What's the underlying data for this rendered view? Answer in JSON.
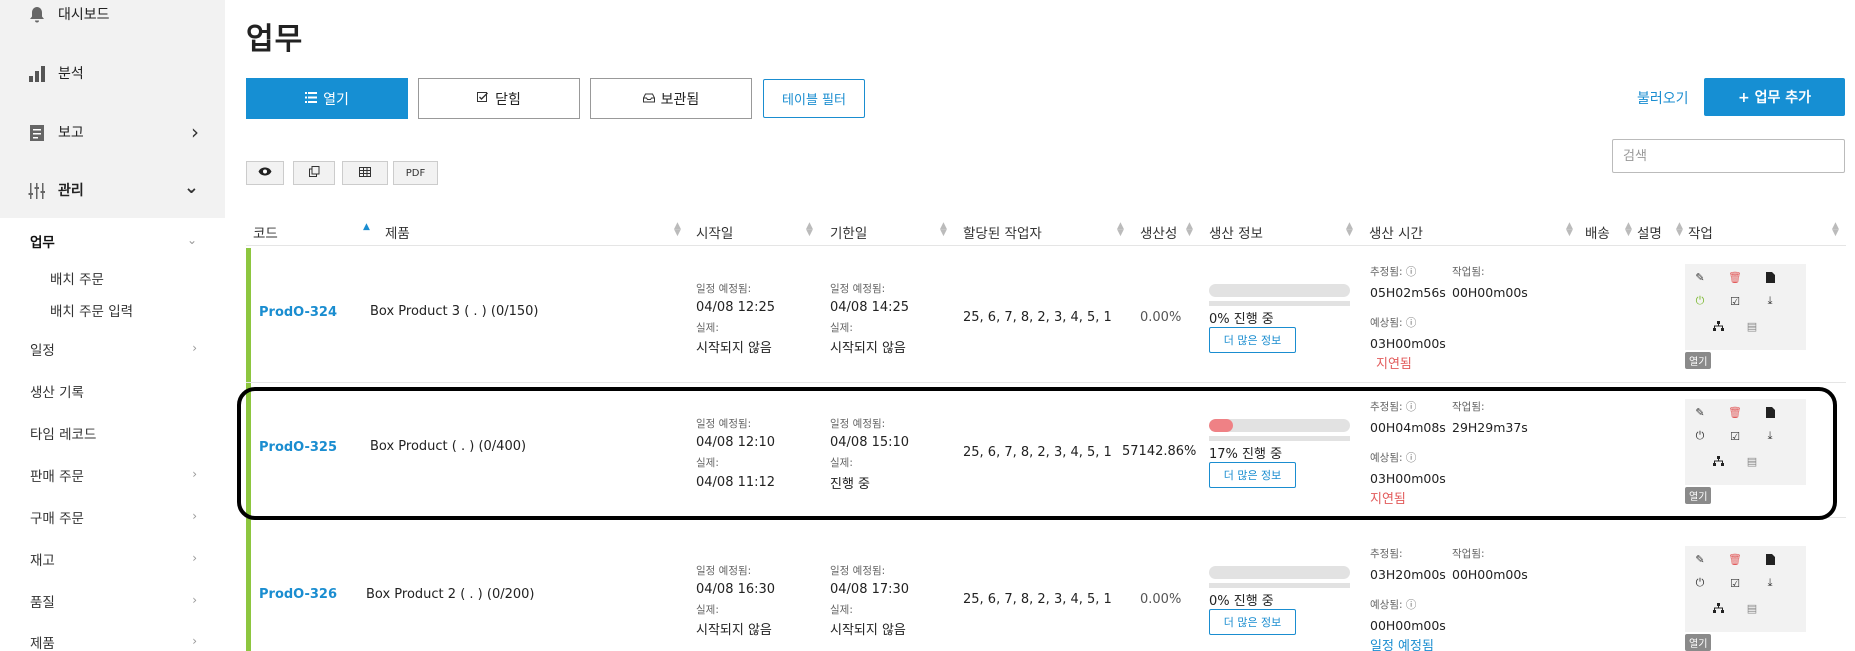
{
  "sidebar": {
    "top_items": [
      {
        "label": "대시보드",
        "icon": "bell-icon"
      },
      {
        "label": "분석",
        "icon": "bar-chart-icon"
      },
      {
        "label": "보고",
        "icon": "report-icon",
        "chevron": "›"
      },
      {
        "label": "관리",
        "icon": "sliders-icon",
        "chevron": "⌄"
      }
    ],
    "items": [
      {
        "label": "업무",
        "active": true
      },
      {
        "label": "배치 주문",
        "sub": true
      },
      {
        "label": "배치 주문 입력",
        "sub": true
      },
      {
        "label": "일정"
      },
      {
        "label": "생산 기록"
      },
      {
        "label": "타임 레코드"
      },
      {
        "label": "판매 주문"
      },
      {
        "label": "구매 주문"
      },
      {
        "label": "재고"
      },
      {
        "label": "품질"
      },
      {
        "label": "제품"
      }
    ]
  },
  "page": {
    "title": "업무",
    "tabs": [
      {
        "label": "열기",
        "icon": "list-icon",
        "active": true
      },
      {
        "label": "닫힘",
        "icon": "check-square-icon"
      },
      {
        "label": "보관됨",
        "icon": "inbox-icon"
      }
    ],
    "table_filter": "테이블 필터",
    "load_link": "불러오기",
    "add_button": "+ 업무 추가",
    "search_placeholder": "검색",
    "small_buttons": [
      {
        "icon": "eye-icon"
      },
      {
        "icon": "copy-icon"
      },
      {
        "icon": "table-icon"
      },
      {
        "label": "PDF"
      }
    ]
  },
  "table": {
    "columns": [
      "코드",
      "제품",
      "시작일",
      "기한일",
      "할당된 작업자",
      "생산성",
      "생산 정보",
      "생산 시간",
      "배송",
      "설명",
      "작업"
    ],
    "labels": {
      "scheduled": "일정 예정됨:",
      "actual": "실제:",
      "estimated": "추정됨:",
      "worked": "작업됨:",
      "expected": "예상됨:",
      "more_info": "더 많은 정보",
      "open_badge": "열기"
    },
    "rows": [
      {
        "code": "ProdO-324",
        "product": "Box Product 3 ( . ) (0/150)",
        "start_sched": "04/08   12:25",
        "start_actual": "시작되지 않음",
        "due_sched": "04/08   14:25",
        "due_actual": "시작되지 않음",
        "workers": "25, 6, 7, 8, 2, 3, 4, 5, 1",
        "productivity": "0.00%",
        "progress": 0,
        "progress_text": "0% 진행 중",
        "estimated": "05H02m56s",
        "worked": "00H00m00s",
        "expected": "03H00m00s",
        "status": "지연됨",
        "status_type": "late"
      },
      {
        "code": "ProdO-325",
        "product": "Box Product ( . ) (0/400)",
        "start_sched": "04/08   12:10",
        "start_actual": "04/08   11:12",
        "due_sched": "04/08   15:10",
        "due_actual": "진행 중",
        "workers": "25, 6, 7, 8, 2, 3, 4, 5, 1",
        "productivity": "57142.86%",
        "progress": 17,
        "progress_text": "17% 진행 중",
        "estimated": "00H04m08s",
        "worked": "29H29m37s",
        "expected": "03H00m00s",
        "status": "지연됨",
        "status_type": "late"
      },
      {
        "code": "ProdO-326",
        "product": "Box Product 2 ( . ) (0/200)",
        "start_sched": "04/08   16:30",
        "start_actual": "시작되지 않음",
        "due_sched": "04/08   17:30",
        "due_actual": "시작되지 않음",
        "workers": "25, 6, 7, 8, 2, 3, 4, 5, 1",
        "productivity": "0.00%",
        "progress": 0,
        "progress_text": "0% 진행 중",
        "estimated": "03H20m00s",
        "worked": "00H00m00s",
        "expected": "00H00m00s",
        "status": "일정 예정됨",
        "status_type": "scheduled"
      }
    ]
  },
  "colors": {
    "accent": "#168fd3",
    "row_bar": "#8dc63f",
    "late": "#e25b5b",
    "progress_fill": "#ef8185"
  }
}
